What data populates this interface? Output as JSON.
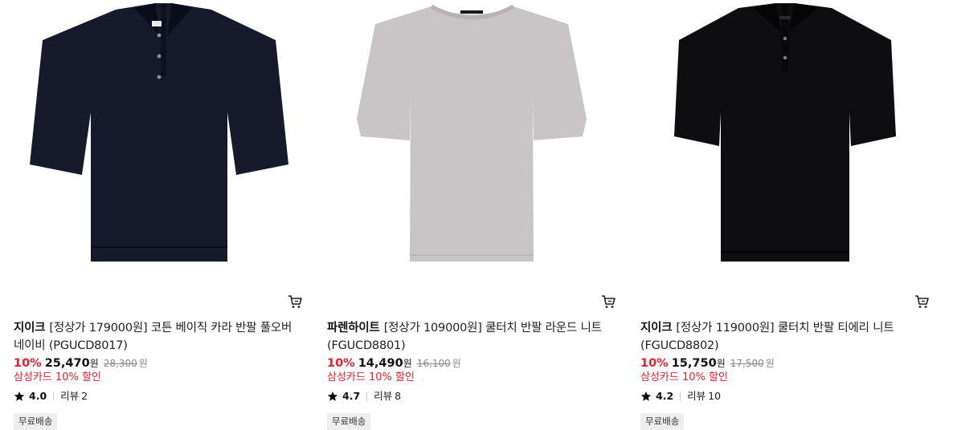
{
  "products": [
    {
      "brand": "지이크",
      "title": "[정상가 179000원] 코튼 베이직 카라 반팔 풀오버 네이비 (PGUCD8017)",
      "discount_rate": "10%",
      "sale_price": "25,470",
      "sale_unit": "원",
      "original_price": "28,300",
      "original_unit": "원",
      "card_promo": "삼성카드 10% 할인",
      "rating": "4.0",
      "review_label": "리뷰",
      "review_count": "2",
      "shipping_badge": "무료배송",
      "image": {
        "garment": "polo",
        "color": "#161a2b"
      },
      "cart_icon": "cart-icon"
    },
    {
      "brand": "파렌하이트",
      "title": "[정상가 109000원] 쿨터치 반팔 라운드 니트 (FGUCD8801)",
      "discount_rate": "10%",
      "sale_price": "14,490",
      "sale_unit": "원",
      "original_price": "16,100",
      "original_unit": "원",
      "card_promo": "삼성카드 10% 할인",
      "rating": "4.7",
      "review_label": "리뷰",
      "review_count": "8",
      "shipping_badge": "무료배송",
      "image": {
        "garment": "tee",
        "color": "#c9c4c5"
      },
      "cart_icon": "cart-icon"
    },
    {
      "brand": "지이크",
      "title": "[정상가 119000원] 쿨터치 반팔 티에리 니트 (FGUCD8802)",
      "discount_rate": "10%",
      "sale_price": "15,750",
      "sale_unit": "원",
      "original_price": "17,500",
      "original_unit": "원",
      "card_promo": "삼성카드 10% 할인",
      "rating": "4.2",
      "review_label": "리뷰",
      "review_count": "10",
      "shipping_badge": "무료배송",
      "image": {
        "garment": "polo",
        "color": "#0e0e10"
      },
      "cart_icon": "cart-icon"
    }
  ],
  "colors": {
    "discount": "#e4202e",
    "badge_bg": "#eeeeee",
    "strike": "#888888"
  }
}
